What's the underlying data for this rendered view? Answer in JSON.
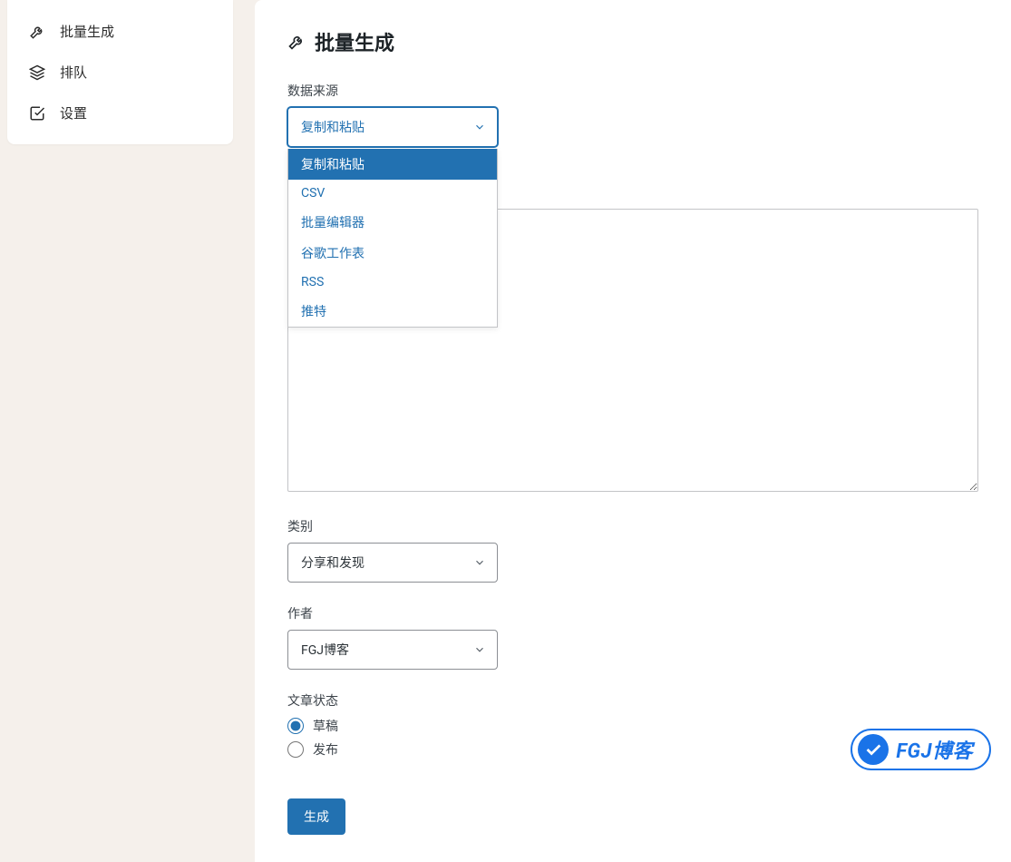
{
  "sidebar": {
    "items": [
      {
        "label": "批量生成"
      },
      {
        "label": "排队"
      },
      {
        "label": "设置"
      }
    ]
  },
  "page": {
    "title": "批量生成"
  },
  "form": {
    "data_source": {
      "label": "数据来源",
      "selected": "复制和粘贴",
      "options": [
        "复制和粘贴",
        "CSV",
        "批量编辑器",
        "谷歌工作表",
        "RSS",
        "推特"
      ]
    },
    "content": {
      "value": ""
    },
    "category": {
      "label": "类别",
      "selected": "分享和发现"
    },
    "author": {
      "label": "作者",
      "selected": "FGJ博客"
    },
    "post_status": {
      "label": "文章状态",
      "options": [
        {
          "label": "草稿",
          "checked": true
        },
        {
          "label": "发布",
          "checked": false
        }
      ]
    },
    "submit_label": "生成"
  },
  "watermark": {
    "text": "FGJ博客"
  }
}
